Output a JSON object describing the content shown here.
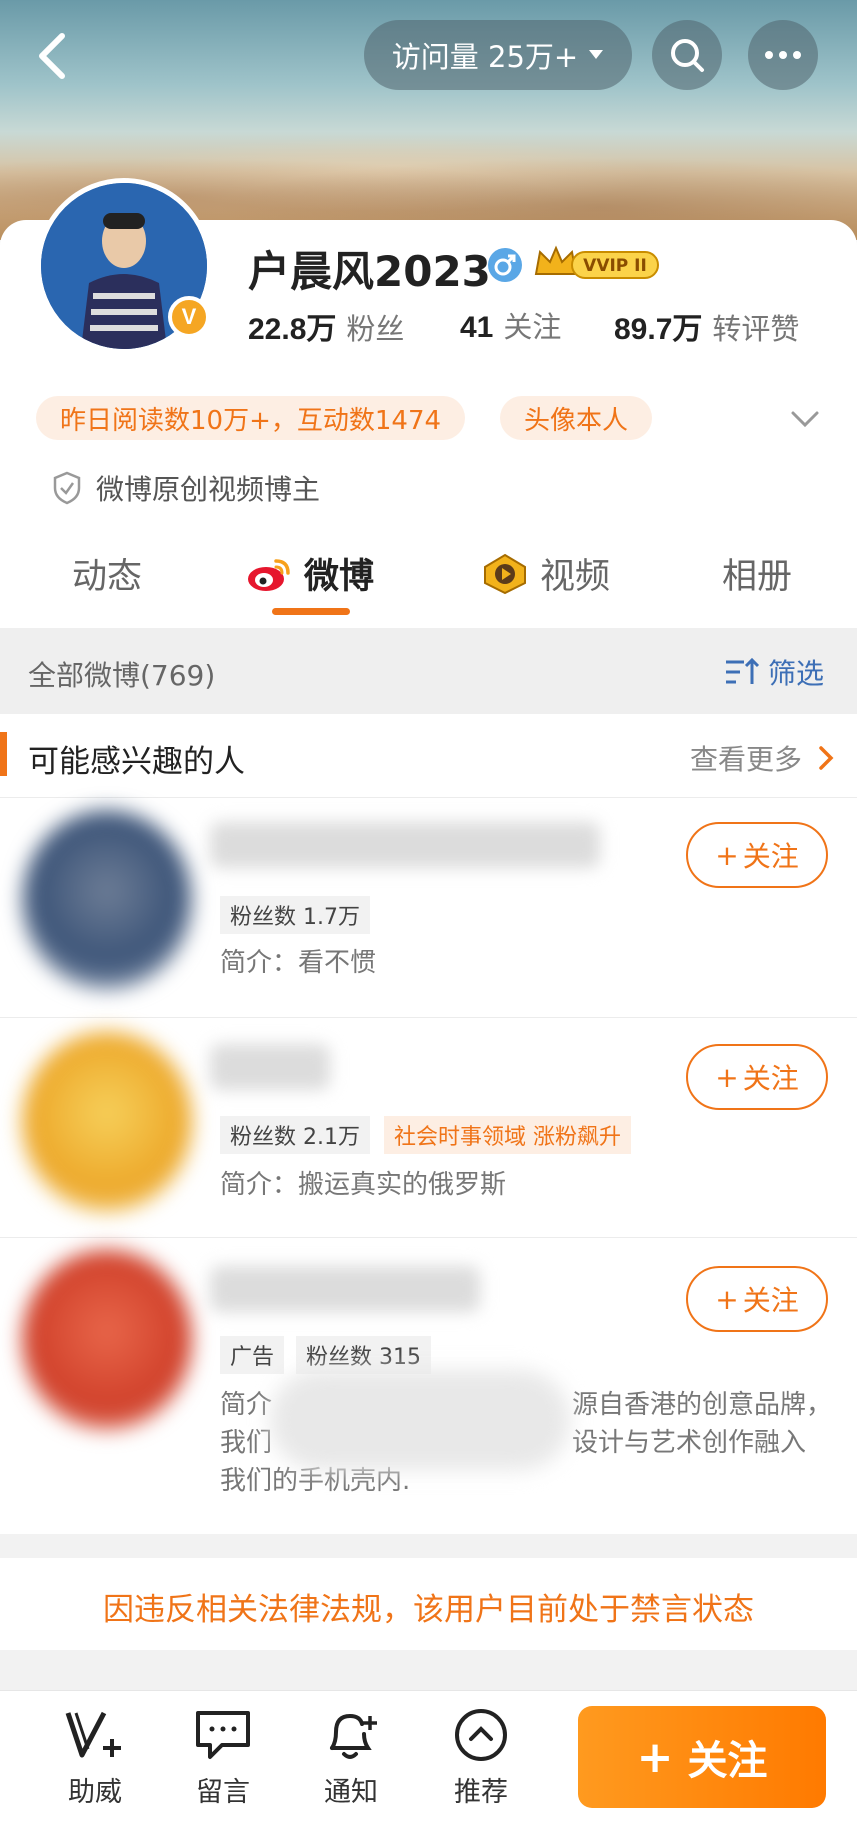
{
  "header": {
    "visits_label": "访问量 25万+"
  },
  "profile": {
    "name": "户晨风2023",
    "vip_badge": "VVIP II",
    "stats": [
      {
        "value": "22.8万",
        "label": "粉丝"
      },
      {
        "value": "41",
        "label": "关注"
      },
      {
        "value": "89.7万",
        "label": "转评赞"
      }
    ],
    "tags": [
      "昨日阅读数10万+，互动数1474",
      "头像本人"
    ],
    "certification": "微博原创视频博主"
  },
  "tabs": [
    {
      "label": "动态"
    },
    {
      "label": "微博"
    },
    {
      "label": "视频"
    },
    {
      "label": "相册"
    }
  ],
  "feed": {
    "all_label": "全部微博(769)",
    "filter_label": "筛选"
  },
  "recommend": {
    "title": "可能感兴趣的人",
    "more": "查看更多",
    "people": [
      {
        "chips": [
          "粉丝数 1.7万"
        ],
        "bio": "简介：看不惯",
        "follow": "关注",
        "avatar_color": "#4a6a8e"
      },
      {
        "chips": [
          "粉丝数 2.1万"
        ],
        "orange_chip": "社会时事领域 涨粉飙升",
        "bio": "简介：搬运真实的俄罗斯",
        "follow": "关注",
        "avatar_color": "#f0b030"
      },
      {
        "chips": [
          "广告",
          "粉丝数 315"
        ],
        "bio_lines": [
          "简介",
          "源自香港的创意品牌，",
          "我们",
          "设计与艺术创作融入",
          "我们的手机壳内."
        ],
        "follow": "关注",
        "avatar_color": "#d94a30"
      }
    ]
  },
  "ban_notice": "因违反相关法律法规，该用户目前处于禁言状态",
  "bottom_bar": {
    "items": [
      {
        "label": "助威"
      },
      {
        "label": "留言"
      },
      {
        "label": "通知"
      },
      {
        "label": "推荐"
      }
    ],
    "follow_label": "关注"
  },
  "colors": {
    "accent": "#f07418",
    "link_blue": "#3d6fb6"
  }
}
